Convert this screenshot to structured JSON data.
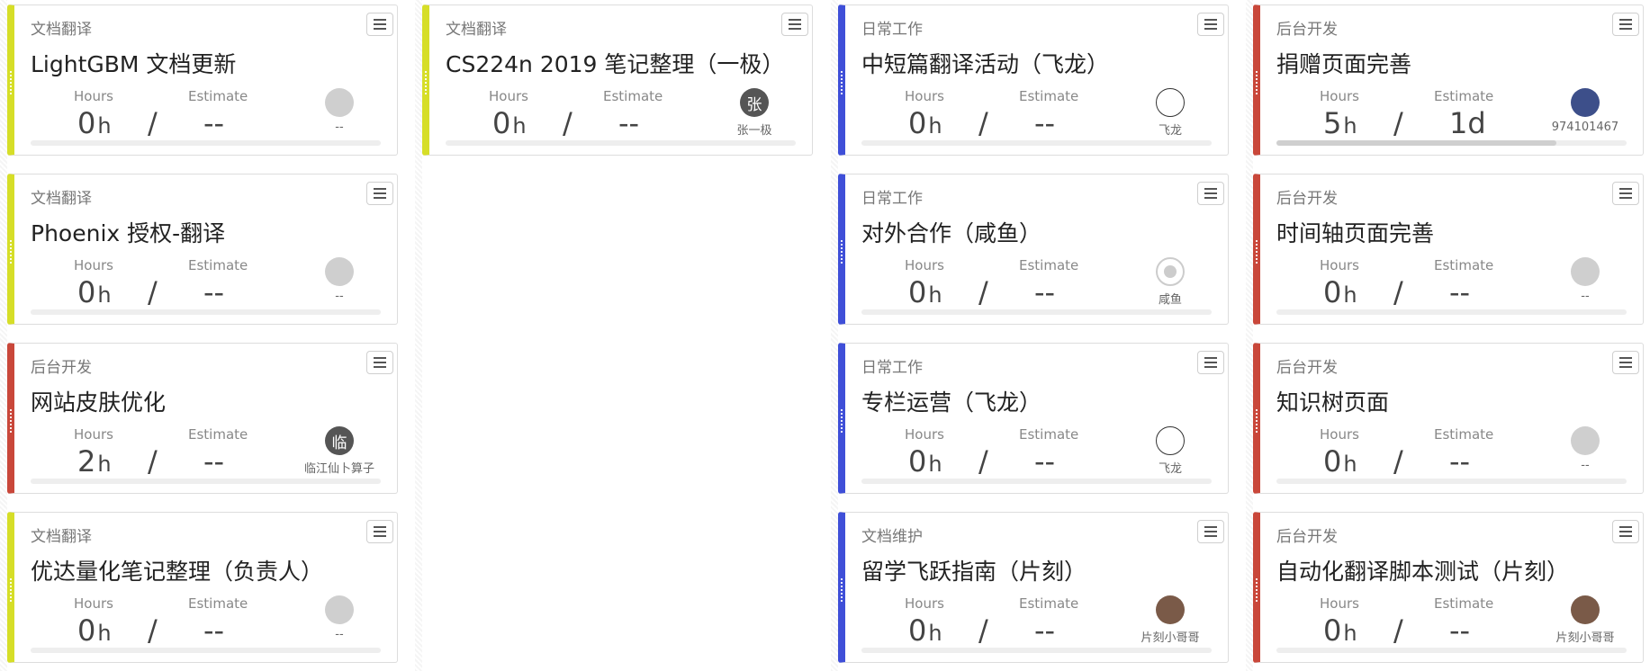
{
  "labels": {
    "hours": "Hours",
    "estimate": "Estimate",
    "hours_unit": "h",
    "slash": "/"
  },
  "colors": {
    "doc_translation": "#d6de28",
    "daily_work": "#3f4fd8",
    "backend_dev": "#c9473a"
  },
  "columns": [
    {
      "cards": [
        {
          "category": "文档翻译",
          "title": "LightGBM 文档更新",
          "hours": "0",
          "estimate": "--",
          "assignee": "--",
          "avatar_char": "",
          "icon": "grey-circle-avatar"
        },
        {
          "category": "文档翻译",
          "title": "Phoenix 授权-翻译",
          "hours": "0",
          "estimate": "--",
          "assignee": "--",
          "avatar_char": "",
          "icon": "grey-circle-avatar"
        },
        {
          "category": "后台开发",
          "title": "网站皮肤优化",
          "hours": "2",
          "estimate": "--",
          "assignee": "临江仙卜算子",
          "avatar_char": "临",
          "icon": "initial-avatar"
        },
        {
          "category": "文档翻译",
          "title": "优达量化笔记整理（负责人）",
          "hours": "0",
          "estimate": "--",
          "assignee": "--",
          "avatar_char": "",
          "icon": "grey-circle-avatar"
        }
      ]
    },
    {
      "cards": [
        {
          "category": "文档翻译",
          "title": "CS224n 2019 笔记整理（一极）",
          "hours": "0",
          "estimate": "--",
          "assignee": "张一极",
          "avatar_char": "张",
          "icon": "initial-avatar"
        }
      ]
    },
    {
      "cards": [
        {
          "category": "日常工作",
          "title": "中短篇翻译活动（飞龙）",
          "hours": "0",
          "estimate": "--",
          "assignee": "飞龙",
          "avatar_char": "",
          "icon": "ink-drawing-avatar"
        },
        {
          "category": "日常工作",
          "title": "对外合作（咸鱼）",
          "hours": "0",
          "estimate": "--",
          "assignee": "咸鱼",
          "avatar_char": "",
          "icon": "default-user-avatar"
        },
        {
          "category": "日常工作",
          "title": "专栏运营（飞龙）",
          "hours": "0",
          "estimate": "--",
          "assignee": "飞龙",
          "avatar_char": "",
          "icon": "ink-drawing-avatar"
        },
        {
          "category": "文档维护",
          "title": "留学飞跃指南（片刻）",
          "hours": "0",
          "estimate": "--",
          "assignee": "片刻小哥哥",
          "avatar_char": "",
          "icon": "lamb-photo-avatar"
        }
      ]
    },
    {
      "cards": [
        {
          "category": "后台开发",
          "title": "捐赠页面完善",
          "hours": "5",
          "estimate": "1d",
          "assignee": "974101467",
          "avatar_char": "",
          "icon": "blue-photo-avatar",
          "progress": 0.8
        },
        {
          "category": "后台开发",
          "title": "时间轴页面完善",
          "hours": "0",
          "estimate": "--",
          "assignee": "--",
          "avatar_char": "",
          "icon": "grey-circle-avatar"
        },
        {
          "category": "后台开发",
          "title": "知识树页面",
          "hours": "0",
          "estimate": "--",
          "assignee": "--",
          "avatar_char": "",
          "icon": "grey-circle-avatar"
        },
        {
          "category": "后台开发",
          "title": "自动化翻译脚本测试（片刻）",
          "hours": "0",
          "estimate": "--",
          "assignee": "片刻小哥哥",
          "avatar_char": "",
          "icon": "lamb-photo-avatar"
        }
      ]
    }
  ]
}
